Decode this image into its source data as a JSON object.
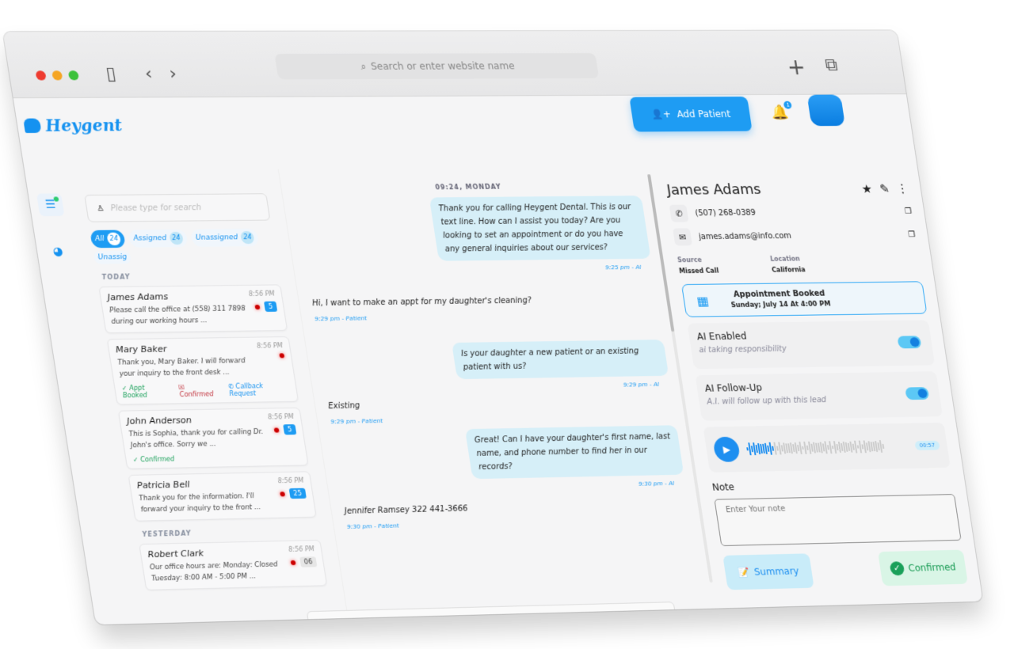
{
  "browser": {
    "search_placeholder": "Search or enter website name",
    "colors": {
      "close": "#ee3b30",
      "minimize": "#f5a524",
      "maximize": "#3cc13b"
    }
  },
  "header": {
    "logo": "Heygent",
    "add_patient": "Add Patient",
    "notifications": "1"
  },
  "list": {
    "search_placeholder": "Please type for search",
    "filters": [
      {
        "label": "All",
        "count": "24"
      },
      {
        "label": "Assigned",
        "count": "24"
      },
      {
        "label": "Unassigned",
        "count": "24"
      },
      {
        "label": "Unassig",
        "count": ""
      }
    ],
    "today": "TODAY",
    "yesterday": "YESTERDAY",
    "items": [
      {
        "name": "James Adams",
        "time": "8:56 PM",
        "preview": "Please call the office at (558) 311 7898 during our working hours ...",
        "count": "5"
      },
      {
        "name": "Mary Baker",
        "time": "8:56 PM",
        "preview": "Thank you, Mary Baker. I will forward your inquiry to the front desk ...",
        "tags": [
          "Appt Booked",
          "Confirmed",
          "Callback Request"
        ]
      },
      {
        "name": "John Anderson",
        "time": "8:56 PM",
        "preview": "This is Sophia, thank you for calling Dr. John's office. Sorry we ...",
        "count": "5",
        "tags": [
          "Confirmed"
        ]
      },
      {
        "name": "Patricia Bell",
        "time": "8:56 PM",
        "preview": "Thank you for the information. I'll forward your inquiry to the front ...",
        "count": "25"
      },
      {
        "name": "Robert Clark",
        "time": "8:56 PM",
        "preview": "Our office hours are: Monday: Closed Tuesday: 8:00 AM - 5:00 PM ...",
        "count": "06"
      }
    ]
  },
  "chat": {
    "day": "09:24, MONDAY",
    "messages": [
      {
        "from": "ai",
        "text": "Thank you for calling Heygent Dental. This is our text line. How can I assist you today? Are you looking to set an appointment or do you have any general inquiries about our services?",
        "meta": "9:25 pm - AI"
      },
      {
        "from": "patient",
        "text": "Hi, I want to make an appt for my daughter's cleaning?",
        "meta": "9:29 pm - Patient"
      },
      {
        "from": "ai",
        "text": "Is your daughter a new patient or an existing patient with us?",
        "meta": "9:29 pm - AI"
      },
      {
        "from": "patient",
        "text": "Existing",
        "meta": "9:29 pm - Patient"
      },
      {
        "from": "ai",
        "text": "Great! Can I have your daughter's first name, last name, and phone number to find her in our records?",
        "meta": "9:30 pm - AI"
      },
      {
        "from": "patient",
        "text": "Jennifer Ramsey 322 441-3666",
        "meta": "9:30 pm - Patient"
      }
    ]
  },
  "patient": {
    "name": "James Adams",
    "phone": "(507) 268-0389",
    "email": "james.adams@info.com",
    "source_label": "Source",
    "source": "Missed Call",
    "location_label": "Location",
    "location": "California",
    "appointment_title": "Appointment Booked",
    "appointment_time": "Sunday; July 14 At 4:00 PM",
    "ai_enabled": {
      "title": "AI Enabled",
      "subtitle": "ai taking responsibility",
      "on": true
    },
    "ai_followup": {
      "title": "AI Follow-Up",
      "subtitle": "A.I. will follow up with this lead",
      "on": true
    },
    "audio_duration": "00:57",
    "audio_progress": 0.2,
    "note_label": "Note",
    "note_placeholder": "Enter Your note",
    "summary": "Summary",
    "confirmed": "Confirmed"
  }
}
